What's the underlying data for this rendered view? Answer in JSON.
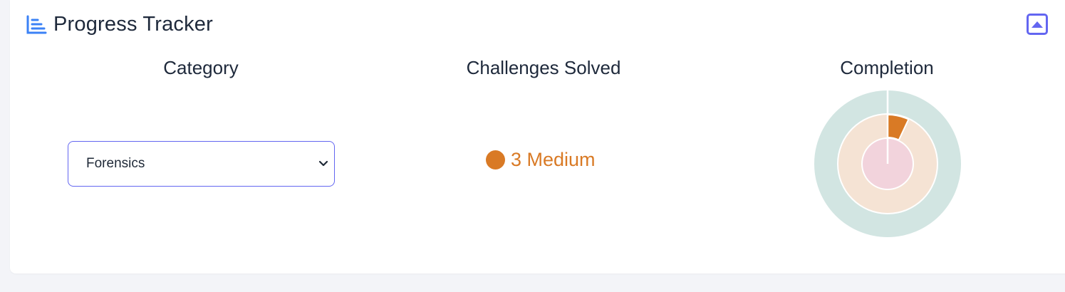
{
  "header": {
    "title": "Progress Tracker",
    "icon": "bar-chart-icon",
    "collapse_icon": "chevron-up-square-icon",
    "accent": "#6366f1"
  },
  "columns": {
    "category": "Category",
    "challenges_solved": "Challenges Solved",
    "completion": "Completion"
  },
  "category_select": {
    "selected": "Forensics",
    "icon": "chevron-down-icon"
  },
  "solved": {
    "text": "3 Medium",
    "color": "#d97a25"
  },
  "completion_chart": {
    "rings": [
      {
        "name": "outer",
        "fraction": 0.0,
        "track_color": "#d2e5e2"
      },
      {
        "name": "middle",
        "fraction": 0.07,
        "fill_color": "#d97a25",
        "track_color": "#f5e3d4"
      },
      {
        "name": "inner",
        "fraction": 0.0,
        "track_color": "#f2d3dc"
      }
    ]
  }
}
